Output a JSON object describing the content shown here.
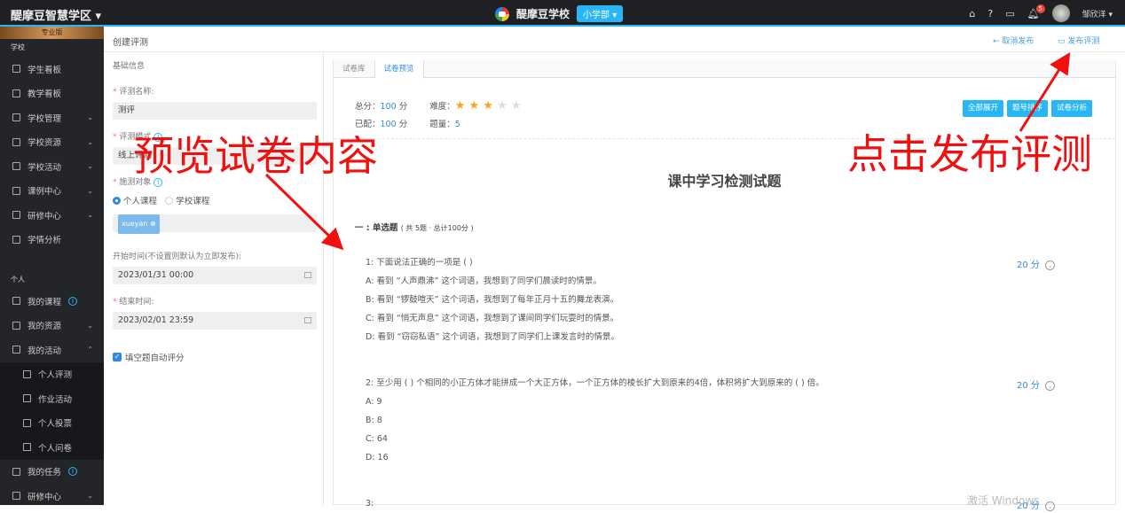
{
  "topbar": {
    "brand": "醍摩豆智慧学区",
    "school": "醍摩豆学校",
    "dept": "小学部",
    "notification_count": "5",
    "user": "邹欣洋"
  },
  "sidebar": {
    "pro": "专业版",
    "school_label": "学校",
    "school_items": [
      "学生看板",
      "教学看板",
      "学校管理",
      "学校资源",
      "学校活动",
      "课例中心",
      "研修中心",
      "学情分析"
    ],
    "personal_label": "个人",
    "personal_items": [
      "我的课程",
      "我的资源",
      "我的活动"
    ],
    "activity_sub": [
      "个人评测",
      "作业活动",
      "个人投票",
      "个人问卷"
    ],
    "personal_tail": [
      "我的任务",
      "研修中心"
    ]
  },
  "header": {
    "title": "创建评测",
    "cancel": "取消发布",
    "publish": "发布评测"
  },
  "form": {
    "section": "基础信息",
    "name_label": "评测名称:",
    "name_value": "测评",
    "mode_label": "评测模式",
    "mode_value": "线上评测",
    "target_label": "施测对象",
    "radio1": "个人课程",
    "radio2": "学校课程",
    "tag": "xueyan",
    "start_label": "开始时间(不设置则默认为立即发布):",
    "start_value": "2023/01/31 00:00",
    "end_label": "结束时间:",
    "end_value": "2023/02/01 23:59",
    "auto_score": "填空题自动评分"
  },
  "panel": {
    "tabs": [
      "试卷库",
      "试卷预览"
    ],
    "total_label": "总分：",
    "total": "100",
    "unit": "分",
    "assigned_label": "已配：",
    "assigned": "100",
    "difficulty_label": "难度：",
    "difficulty": 3,
    "count_label": "题量：",
    "count": "5",
    "buttons": [
      "全部展开",
      "题号排序",
      "试卷分析"
    ],
    "title": "课中学习检测试题",
    "section": "一 : 单选题",
    "section_note": "( 共 5题 · 总计100分 )",
    "questions": [
      {
        "stem": "1:  下面说法正确的一项是 (   )",
        "score": "20 分",
        "options": [
          "A:  看到 “人声鼎沸” 这个词语，我想到了同学们晨读时的情景。",
          "B:  看到 “锣鼓喧天” 这个词语，我想到了每年正月十五的舞龙表演。",
          "C:  看到 “悄无声息” 这个词语，我想到了课间同学们玩耍时的情景。",
          "D:  看到 “窃窃私语” 这个词语，我想到了同学们上课发言时的情景。"
        ]
      },
      {
        "stem": "2:  至少用 (   ) 个相同的小正方体才能拼成一个大正方体，一个正方体的棱长扩大到原来的4倍，体积将扩大到原来的 (   ) 倍。",
        "score": "20 分",
        "options": [
          "A:  9",
          "B:  8",
          "C:  64",
          "D:  16"
        ]
      },
      {
        "stem": "3:",
        "score": "20 分",
        "options": []
      }
    ]
  },
  "annotations": {
    "left": "预览试卷内容",
    "right": "点击发布评测"
  },
  "watermark": "激活 Windows"
}
